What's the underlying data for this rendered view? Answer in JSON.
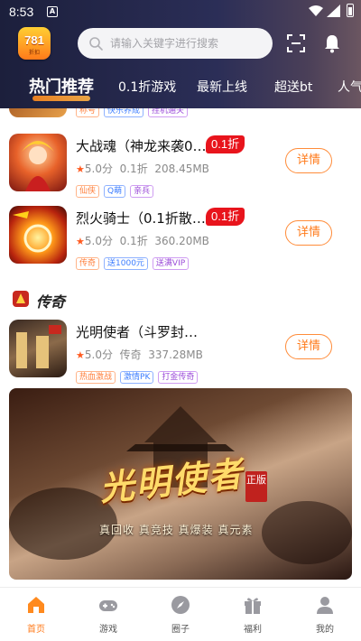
{
  "status_bar": {
    "time": "8:53"
  },
  "header": {
    "logo_text": "781",
    "logo_subtext": "折扣",
    "search_placeholder": "请输入关键字进行搜索"
  },
  "tabs": [
    {
      "label": "热门推荐",
      "active": true
    },
    {
      "label": "0.1折游戏",
      "active": false
    },
    {
      "label": "最新上线",
      "active": false
    },
    {
      "label": "超送bt",
      "active": false
    },
    {
      "label": "人气",
      "active": false
    }
  ],
  "partial_row_tags": [
    "称号",
    "快乐养成",
    "挂机通关"
  ],
  "games": [
    {
      "name": "大战魂（神龙来袭0…",
      "badge": "0.1折",
      "rating": "5.0分",
      "category": "0.1折",
      "size": "208.45MB",
      "tags": [
        "仙侠",
        "Q萌",
        "亲兵"
      ],
      "detail_label": "详情"
    },
    {
      "name": "烈火骑士（0.1折散…",
      "badge": "0.1折",
      "rating": "5.0分",
      "category": "0.1折",
      "size": "360.20MB",
      "tags": [
        "传奇",
        "送1000元",
        "送满VIP"
      ],
      "detail_label": "详情"
    }
  ],
  "section": {
    "title": "传奇"
  },
  "legend_game": {
    "name": "光明使者（斗罗封…",
    "rating": "5.0分",
    "category": "传奇",
    "size": "337.28MB",
    "tags": [
      "热血激战",
      "激情PK",
      "打金传奇"
    ],
    "detail_label": "详情"
  },
  "banner": {
    "title": "光明使者",
    "seal": "正版",
    "subtitle": "真回收 真竞技 真爆装 真元素"
  },
  "bottom_nav": [
    {
      "label": "首页",
      "icon": "home-icon",
      "active": true
    },
    {
      "label": "游戏",
      "icon": "gamepad-icon",
      "active": false
    },
    {
      "label": "圈子",
      "icon": "compass-icon",
      "active": false
    },
    {
      "label": "福利",
      "icon": "gift-icon",
      "active": false
    },
    {
      "label": "我的",
      "icon": "user-icon",
      "active": false
    }
  ],
  "colors": {
    "accent": "#ff7a1a",
    "badge_red": "#e8141c",
    "header_bg": "#1c1f3c"
  }
}
